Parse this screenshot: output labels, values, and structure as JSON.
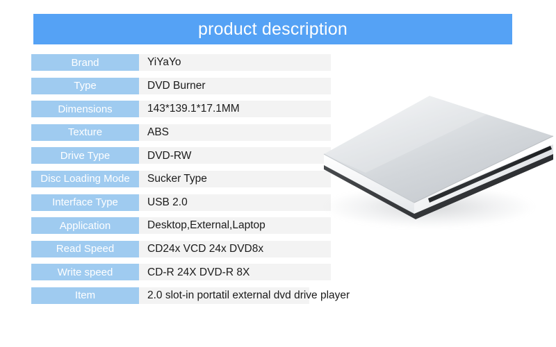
{
  "header": {
    "title": "product description",
    "bar_color": "#55a2f5",
    "title_color": "#ffffff"
  },
  "spec_table": {
    "label_color": "#9fcbf0",
    "label_text_color": "#ffffff",
    "value_bg_color": "#f3f3f3",
    "value_text_color": "#1a1a1a",
    "rows": [
      {
        "label": "Brand",
        "value": "YiYaYo"
      },
      {
        "label": "Type",
        "value": "DVD Burner"
      },
      {
        "label": "Dimensions",
        "value": "143*139.1*17.1MM"
      },
      {
        "label": "Texture",
        "value": "ABS"
      },
      {
        "label": "Drive Type",
        "value": "DVD-RW"
      },
      {
        "label": "Disc Loading Mode",
        "value": "Sucker Type"
      },
      {
        "label": "Interface Type",
        "value": "USB 2.0"
      },
      {
        "label": "Application",
        "value": "Desktop,External,Laptop"
      },
      {
        "label": "Read Speed",
        "value": "CD24x VCD 24x DVD8x"
      },
      {
        "label": "Write speed",
        "value": "CD-R 24X DVD-R 8X"
      },
      {
        "label": "Item",
        "value": "2.0 slot-in portatil external dvd drive player"
      }
    ]
  },
  "product_image": {
    "name": "external-slot-in-dvd-drive",
    "body_color": "#e9ebed",
    "top_color": "#d9dcdf",
    "base_color": "#3b3d40",
    "slot_color": "#2a2c2e"
  }
}
